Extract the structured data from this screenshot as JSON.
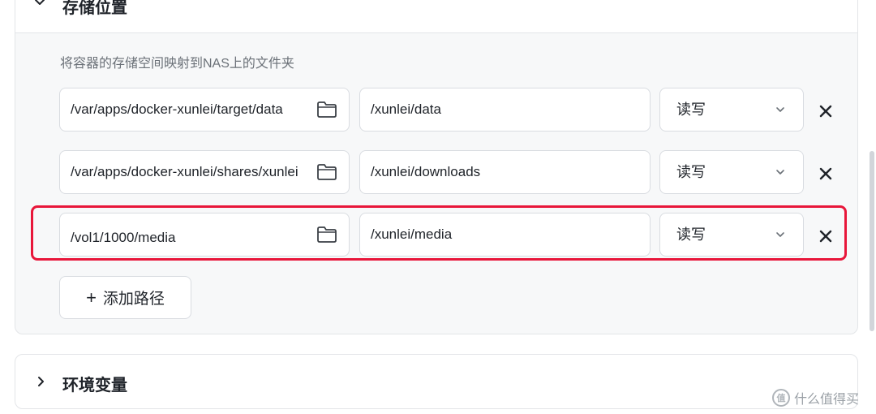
{
  "storage_section": {
    "title": "存储位置",
    "description": "将容器的存储空间映射到NAS上的文件夹",
    "mappings": [
      {
        "host_path": "/var/apps/docker-xunlei/target/data",
        "container_path": "/xunlei/data",
        "permission": "读写"
      },
      {
        "host_path": "/var/apps/docker-xunlei/shares/xunlei",
        "container_path": "/xunlei/downloads",
        "permission": "读写"
      },
      {
        "host_path": "/vol1/1000/media",
        "container_path": "/xunlei/media",
        "permission": "读写"
      }
    ],
    "add_button_label": "添加路径"
  },
  "env_section": {
    "title": "环境变量"
  },
  "watermark": {
    "badge": "值",
    "text": "什么值得买"
  },
  "colors": {
    "highlight": "#e8163a",
    "border": "#d9dce1",
    "muted_text": "#6b7178"
  },
  "icons": [
    "chevron-down-icon",
    "folder-icon",
    "caret-down-icon",
    "close-icon",
    "plus-icon",
    "chevron-right-icon"
  ]
}
